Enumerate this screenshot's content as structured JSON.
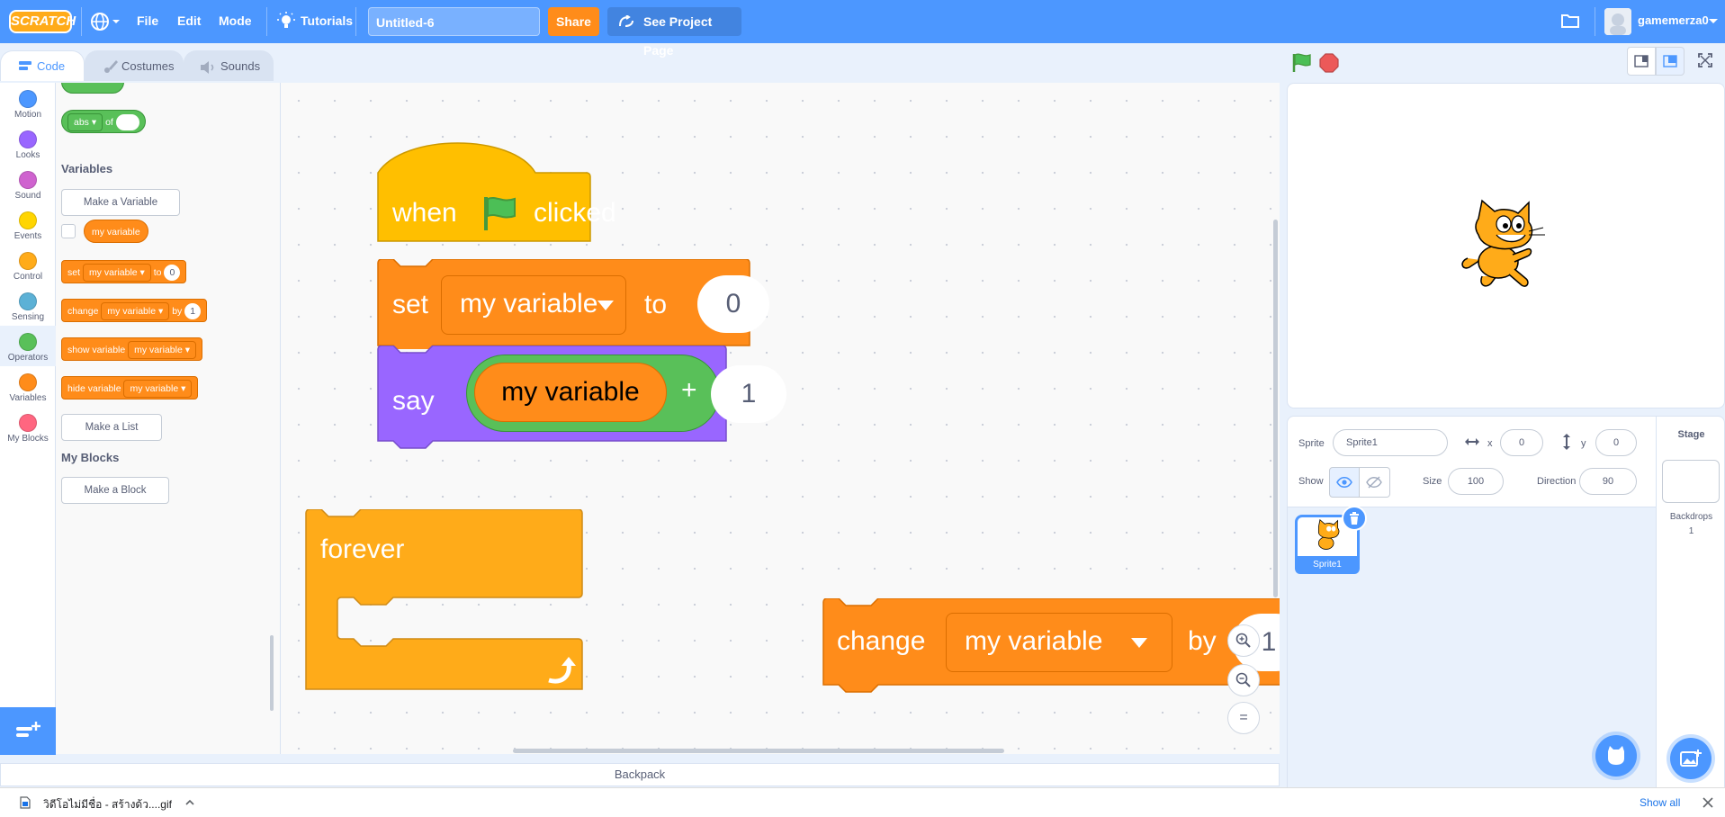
{
  "menubar": {
    "logo": "SCRATCH",
    "file": "File",
    "edit": "Edit",
    "mode": "Mode",
    "tutorials": "Tutorials",
    "project_title": "Untitled-6",
    "share": "Share",
    "see_project_page": "See Project Page",
    "username": "gamemerza0"
  },
  "tabs": [
    {
      "label": "Code",
      "active": true
    },
    {
      "label": "Costumes",
      "active": false
    },
    {
      "label": "Sounds",
      "active": false
    }
  ],
  "categories": [
    {
      "label": "Motion",
      "color": "#4c97ff"
    },
    {
      "label": "Looks",
      "color": "#9966ff"
    },
    {
      "label": "Sound",
      "color": "#cf63cf"
    },
    {
      "label": "Events",
      "color": "#ffd500"
    },
    {
      "label": "Control",
      "color": "#ffab19"
    },
    {
      "label": "Sensing",
      "color": "#5cb1d6"
    },
    {
      "label": "Operators",
      "color": "#59c059"
    },
    {
      "label": "Variables",
      "color": "#ff8c1a"
    },
    {
      "label": "My Blocks",
      "color": "#ff6680"
    }
  ],
  "palette": {
    "abs_block": {
      "fn": "abs",
      "of": "of"
    },
    "variables_title": "Variables",
    "make_variable": "Make a Variable",
    "variable_name": "my variable",
    "set_block": {
      "set": "set",
      "var": "my variable",
      "to": "to",
      "value": "0"
    },
    "change_block": {
      "change": "change",
      "var": "my variable",
      "by": "by",
      "value": "1"
    },
    "show_block": {
      "label": "show variable",
      "var": "my variable"
    },
    "hide_block": {
      "label": "hide variable",
      "var": "my variable"
    },
    "make_list": "Make a List",
    "my_blocks_title": "My Blocks",
    "make_block": "Make a Block"
  },
  "script": {
    "hat": {
      "when": "when",
      "clicked": "clicked"
    },
    "set": {
      "label": "set",
      "var": "my variable",
      "to": "to",
      "value": "0"
    },
    "say": {
      "label": "say",
      "var": "my variable",
      "op": "+",
      "value": "1"
    },
    "forever": "forever",
    "change": {
      "label": "change",
      "var": "my variable",
      "by": "by",
      "value": "1"
    }
  },
  "zoom": {
    "in": "+",
    "out": "−",
    "reset": "="
  },
  "sprite_info": {
    "sprite_label": "Sprite",
    "sprite_name": "Sprite1",
    "x_label": "x",
    "x_value": "0",
    "y_label": "y",
    "y_value": "0",
    "show_label": "Show",
    "size_label": "Size",
    "size_value": "100",
    "direction_label": "Direction",
    "direction_value": "90"
  },
  "sprites": [
    {
      "name": "Sprite1",
      "selected": true
    }
  ],
  "stage_panel": {
    "title": "Stage",
    "backdrops_label": "Backdrops",
    "backdrops_count": "1"
  },
  "backpack": "Backpack",
  "download_bar": {
    "filename": "วิดีโอไม่มีชื่อ - สร้างด้ว....gif",
    "show_all": "Show all"
  }
}
